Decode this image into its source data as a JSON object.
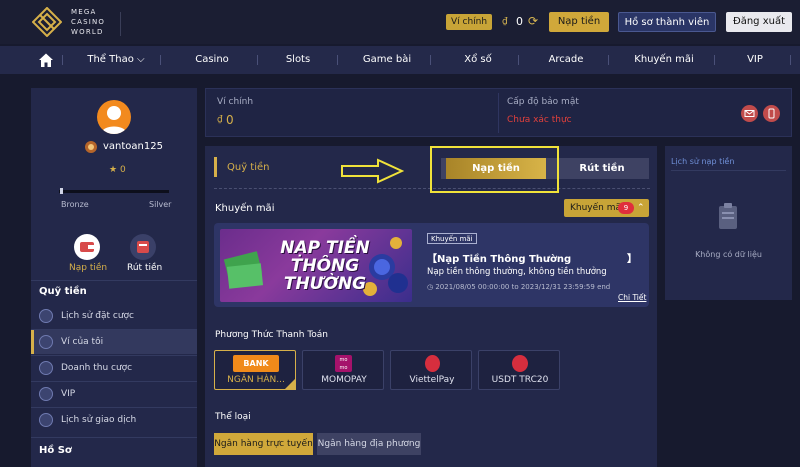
{
  "header": {
    "logo_lines": [
      "MEGA",
      "CASINO",
      "WORLD"
    ],
    "wallet_label": "Ví chính",
    "currency_symbol": "₫",
    "balance": "0",
    "deposit_label": "Nạp tiền",
    "profile_label": "Hồ sơ thành viên",
    "logout_label": "Đăng xuất"
  },
  "nav": {
    "items": [
      "Thể Thao",
      "Casino",
      "Slots",
      "Game bài",
      "Xổ số",
      "Arcade",
      "Khuyến mãi",
      "VIP"
    ]
  },
  "profile": {
    "username": "vantoan125",
    "level": "0",
    "level_from": "Bronze",
    "level_to": "Silver",
    "level_progress": 0.02,
    "quick_deposit": "Nạp tiền",
    "quick_withdraw": "Rút tiền"
  },
  "sidebar": {
    "section_money": "Quỹ tiền",
    "items": [
      "Lịch sử đặt cược",
      "Ví của tôi",
      "Doanh thu cược",
      "VIP",
      "Lịch sử giao dịch"
    ],
    "section_profile": "Hồ Sơ"
  },
  "wallet_card": {
    "main_label": "Ví chính",
    "currency_symbol": "₫",
    "main_value": "0",
    "security_label": "Cấp độ bảo mật",
    "security_value": "Chưa xác thực"
  },
  "main": {
    "title": "Quỹ tiền",
    "tab_deposit": "Nạp tiền",
    "tab_withdraw": "Rút tiền",
    "promo_label": "Khuyến mãi",
    "promo_button": "Khuyến mãi",
    "promo_count": "9",
    "promo": {
      "image_text": "NẠP TIỀN THÔNG THƯỜNG",
      "tag": "Khuyến mãi",
      "title": "【Nạp Tiền Thông Thường",
      "title_end": "】",
      "desc": "Nạp tiền thông thường, không tiền thưởng",
      "time": "2021/08/05 00:00:00 to 2023/12/31 23:59:59 end",
      "detail": "Chi Tiết"
    },
    "payment_label": "Phương Thức Thanh Toán",
    "payment_methods": [
      "NGÂN HÀN...",
      "MOMOPAY",
      "ViettelPay",
      "USDT TRC20"
    ],
    "payment_logos": [
      "BANK",
      "mo mo",
      "",
      ""
    ],
    "category_label": "Thể loại",
    "categories": [
      "Ngân hàng trực tuyến",
      "Ngân hàng địa phương"
    ]
  },
  "right_panel": {
    "title": "Lịch sử nạp tiền",
    "empty": "Không có dữ liệu"
  },
  "colors": {
    "gold": "#d6b04a",
    "bg": "#171a2e",
    "panel": "#23284a",
    "alert_red": "#e0403c",
    "annotation_yellow": "#f0e23a"
  }
}
